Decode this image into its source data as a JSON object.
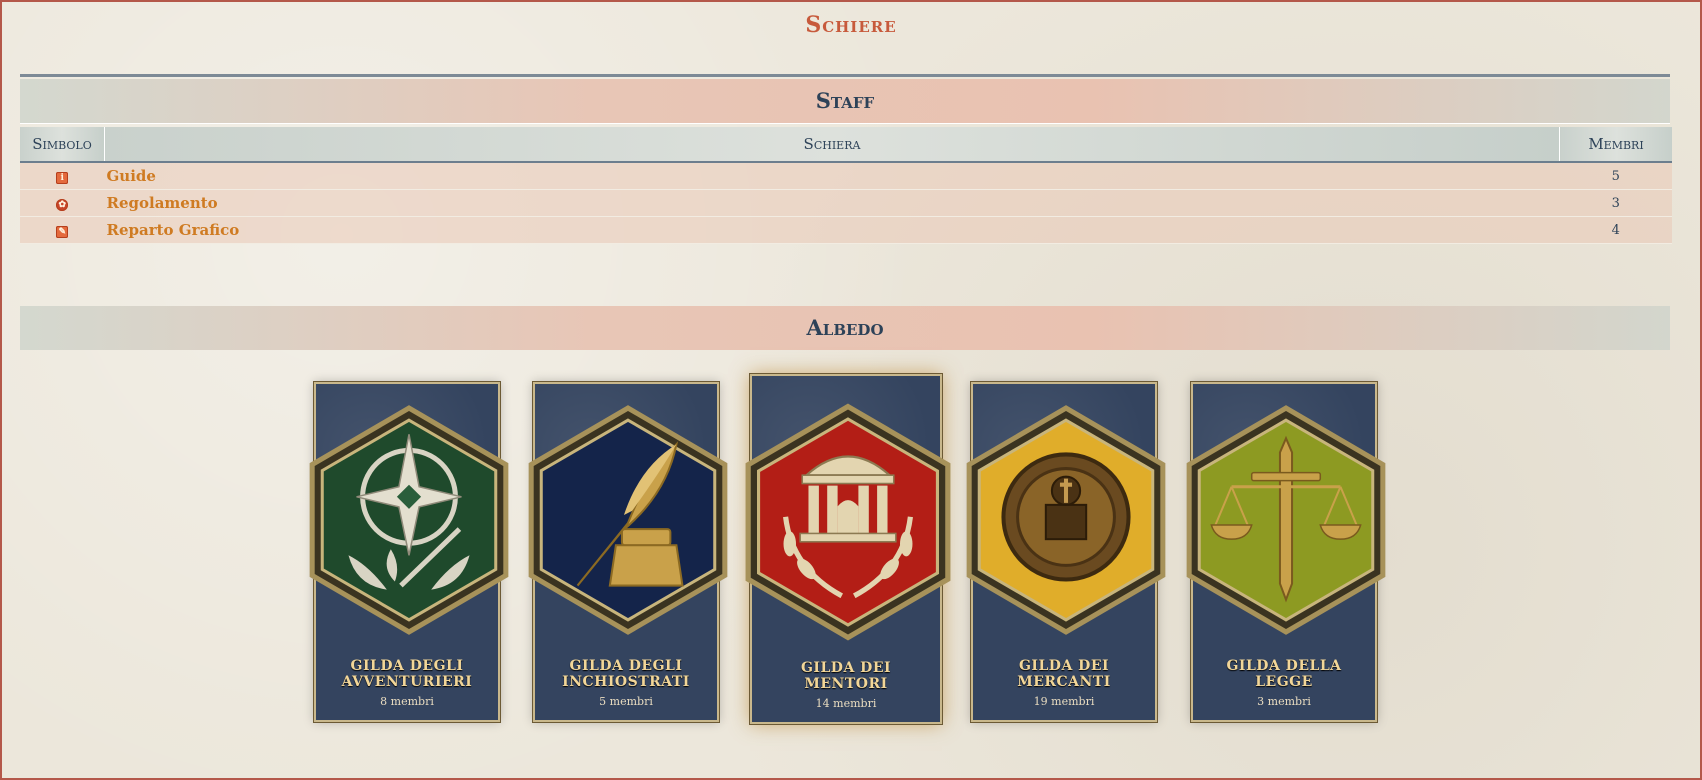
{
  "page": {
    "title": "Schiere"
  },
  "staff": {
    "heading": "Staff",
    "columns": {
      "symbol": "Simbolo",
      "name": "Schiera",
      "members": "Membri"
    },
    "rows": [
      {
        "icon": "info-icon",
        "symbol_glyph": "i",
        "name": "Guide",
        "members": "5"
      },
      {
        "icon": "gear-icon",
        "symbol_glyph": "✿",
        "name": "Regolamento",
        "members": "3"
      },
      {
        "icon": "brush-icon",
        "symbol_glyph": "✎",
        "name": "Reparto Grafico",
        "members": "4"
      }
    ]
  },
  "albedo": {
    "heading": "Albedo",
    "guilds": [
      {
        "name": "Gilda degli Avventurieri",
        "members": "8 membri",
        "icon": "compass-icon",
        "color": "#1f4a2c"
      },
      {
        "name": "Gilda degli Inchiostrati",
        "members": "5 membri",
        "icon": "quill-icon",
        "color": "#14244a"
      },
      {
        "name": "Gilda dei Mentori",
        "members": "14 membri",
        "icon": "temple-icon",
        "color": "#b31e16"
      },
      {
        "name": "Gilda dei Mercanti",
        "members": "19 membri",
        "icon": "coin-icon",
        "color": "#e0ad2a"
      },
      {
        "name": "Gilda della Legge",
        "members": "3 membri",
        "icon": "scales-icon",
        "color": "#8d9a22"
      }
    ]
  }
}
